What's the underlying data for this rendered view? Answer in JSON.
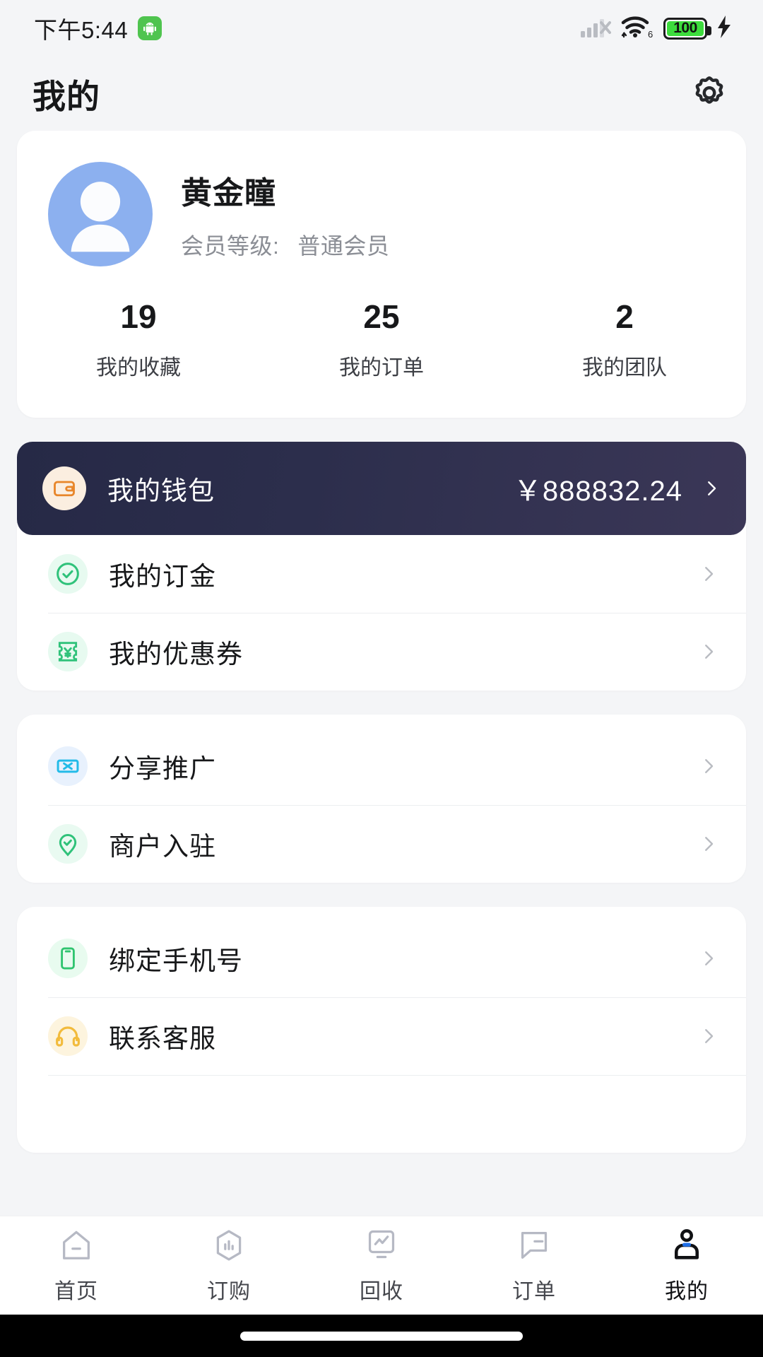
{
  "status_bar": {
    "time": "下午5:44",
    "android_icon": "android-robot-icon",
    "signal_icon": "signal-bars-no-sim-icon",
    "wifi_icon": "wifi-6-icon",
    "battery_level": "100",
    "charging_icon": "lightning-bolt-icon"
  },
  "header": {
    "title": "我的",
    "settings_icon": "gear-icon"
  },
  "profile": {
    "avatar_icon": "user-avatar-placeholder",
    "name": "黄金瞳",
    "level_label": "会员等级:",
    "level_value": "普通会员",
    "stats": [
      {
        "value": "19",
        "label": "我的收藏"
      },
      {
        "value": "25",
        "label": "我的订单"
      },
      {
        "value": "2",
        "label": "我的团队"
      }
    ]
  },
  "wallet": {
    "icon": "wallet-icon",
    "label": "我的钱包",
    "amount": "￥888832.24",
    "chevron": "chevron-right-icon"
  },
  "menu_groups": [
    {
      "items": [
        {
          "label": "我的订金",
          "icon": "check-circle-icon",
          "icon_color": "#2fc27a",
          "bg": "#e7faf0"
        },
        {
          "label": "我的优惠券",
          "icon": "coupon-icon",
          "icon_color": "#2fc27a",
          "bg": "#e7faf0"
        }
      ]
    },
    {
      "items": [
        {
          "label": "分享推广",
          "icon": "share-ticket-icon",
          "icon_color": "#23bbe8",
          "bg": "#e6f2fd"
        },
        {
          "label": "商户入驻",
          "icon": "location-check-icon",
          "icon_color": "#2fc27a",
          "bg": "#e9faf1"
        }
      ]
    },
    {
      "items": [
        {
          "label": "绑定手机号",
          "icon": "phone-icon",
          "icon_color": "#2fc46f",
          "bg": "#e8fbef"
        },
        {
          "label": "联系客服",
          "icon": "headset-icon",
          "icon_color": "#f2bb3c",
          "bg": "#fdf4de"
        }
      ]
    }
  ],
  "tabbar": {
    "tabs": [
      {
        "label": "首页",
        "icon": "home-icon",
        "active": false
      },
      {
        "label": "订购",
        "icon": "hexagon-chart-icon",
        "active": false
      },
      {
        "label": "回收",
        "icon": "monitor-chart-icon",
        "active": false
      },
      {
        "label": "订单",
        "icon": "speech-bubble-icon",
        "active": false
      },
      {
        "label": "我的",
        "icon": "person-icon",
        "active": true
      }
    ]
  },
  "colors": {
    "page_bg": "#f4f5f7",
    "card_bg": "#ffffff",
    "wallet_gradient_from": "#262946",
    "wallet_gradient_to": "#3b3757",
    "wallet_icon_accent": "#e8862a",
    "accent_blue": "#1f6fe8",
    "avatar_blue": "#8cb0ef",
    "text_primary": "#17181a",
    "text_muted": "#8b8e95"
  }
}
